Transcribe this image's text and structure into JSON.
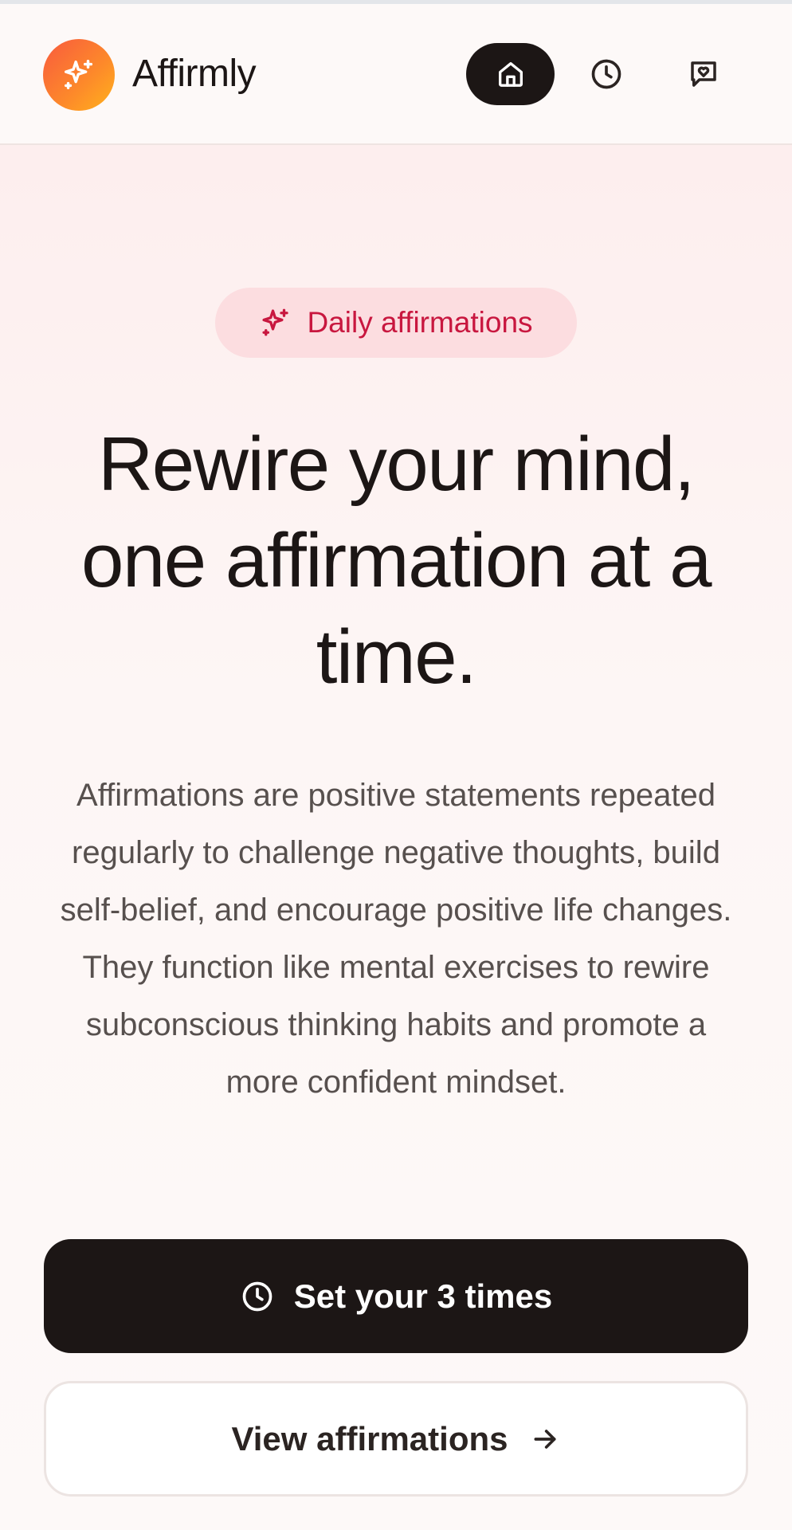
{
  "app": {
    "name": "Affirmly"
  },
  "nav": {
    "items": [
      {
        "icon": "home-icon",
        "active": true
      },
      {
        "icon": "clock-icon",
        "active": false
      },
      {
        "icon": "message-heart-icon",
        "active": false
      }
    ]
  },
  "hero": {
    "badge": "Daily affirmations",
    "headline": "Rewire your mind, one affirmation at a time.",
    "description": "Affirmations are positive statements repeated regularly to challenge negative thoughts, build self-belief, and encourage positive life changes. They function like mental exercises to rewire subconscious thinking habits and promote a more confident mindset."
  },
  "actions": {
    "primary_label": "Set your 3 times",
    "secondary_label": "View affirmations"
  },
  "colors": {
    "logo_gradient_start": "#f85a3e",
    "logo_gradient_end": "#ffb21c",
    "badge_bg": "#fcdde0",
    "badge_text": "#c8173f",
    "primary_bg": "#1c1615"
  }
}
